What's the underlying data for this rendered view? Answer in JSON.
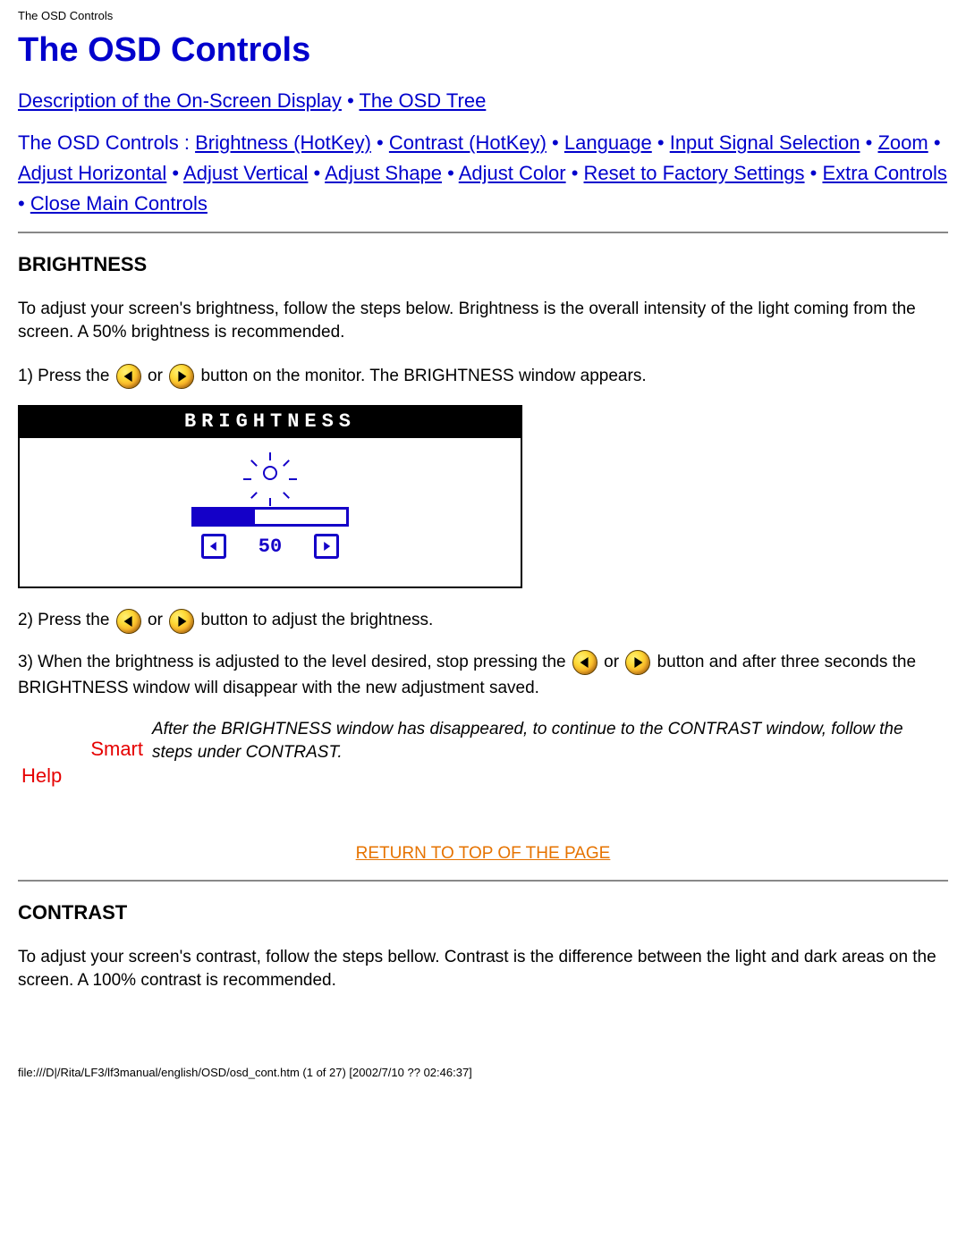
{
  "header_path": "The OSD Controls",
  "title": "The OSD Controls",
  "top_links": {
    "desc": "Description of the On-Screen Display",
    "tree": "The OSD Tree"
  },
  "subnav": {
    "prefix": "The OSD Controls : ",
    "items": [
      "Brightness (HotKey)",
      "Contrast (HotKey)",
      "Language",
      "Input Signal Selection",
      "Zoom",
      "Adjust Horizontal",
      "Adjust Vertical",
      "Adjust Shape",
      "Adjust Color",
      "Reset to Factory Settings",
      "Extra Controls",
      "Close Main Controls"
    ]
  },
  "brightness": {
    "heading": "BRIGHTNESS",
    "intro": "To adjust your screen's brightness, follow the steps below. Brightness is the overall intensity of the light coming from the screen. A 50% brightness is recommended.",
    "step1_a": "1) Press the ",
    "step1_b": " or ",
    "step1_c": " button on the monitor. The BRIGHTNESS window appears.",
    "osd_title": "BRIGHTNESS",
    "osd_value": "50",
    "osd_percent": 40,
    "step2_a": "2) Press the ",
    "step2_b": " or ",
    "step2_c": " button to adjust the brightness.",
    "step3_a": "3) When the brightness is adjusted to the level desired, stop pressing the ",
    "step3_b": " or ",
    "step3_c": " button and after three seconds the BRIGHTNESS window will disappear with the new adjustment saved."
  },
  "smart_help": {
    "smart": "Smart",
    "help": "Help",
    "text": "After the BRIGHTNESS window has disappeared, to continue to the CONTRAST window, follow the steps under CONTRAST."
  },
  "return_link": "RETURN TO TOP OF THE PAGE",
  "contrast": {
    "heading": "CONTRAST",
    "intro": "To adjust your screen's contrast, follow the steps bellow. Contrast is the difference between the light and dark areas on the screen. A 100% contrast is recommended."
  },
  "footer_path": "file:///D|/Rita/LF3/lf3manual/english/OSD/osd_cont.htm (1 of 27) [2002/7/10 ?? 02:46:37]"
}
